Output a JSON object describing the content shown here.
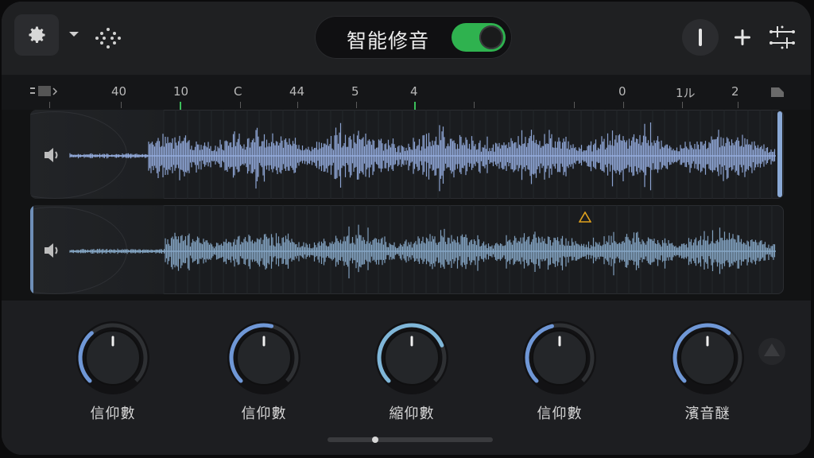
{
  "header": {
    "title": "智能修音",
    "toggle_on": true,
    "colors": {
      "toggle": "#2fb24f",
      "accent": "#8aa9d6"
    },
    "icons": {
      "settings": "gear-icon",
      "dropdown": "chevron-down-icon",
      "left_tool": "scatter-dots-icon",
      "right_1": "marker-icon",
      "right_2": "plus-icon",
      "right_3": "sliders-icon"
    }
  },
  "timeline": {
    "labels": [
      "40",
      "10",
      "C",
      "44",
      "5",
      "4",
      "0",
      "1̲̲̲̲̲̲",
      "2"
    ],
    "labels_display": [
      "40",
      "10",
      "C",
      "44",
      "5",
      "4",
      "0",
      "1ル",
      "2"
    ]
  },
  "tracks": [
    {
      "name": "track-1",
      "icon": "speaker-icon"
    },
    {
      "name": "track-2",
      "icon": "speaker-icon",
      "warning_icon": "warning-triangle-icon"
    }
  ],
  "knobs": [
    {
      "label": "信仰數",
      "value": 0.35
    },
    {
      "label": "信仰數",
      "value": 0.55
    },
    {
      "label": "縮仰數",
      "value": 0.75
    },
    {
      "label": "信仰數",
      "value": 0.45
    },
    {
      "label": "濱音醚",
      "value": 0.65
    }
  ],
  "scroll": {
    "position": 0.28
  }
}
